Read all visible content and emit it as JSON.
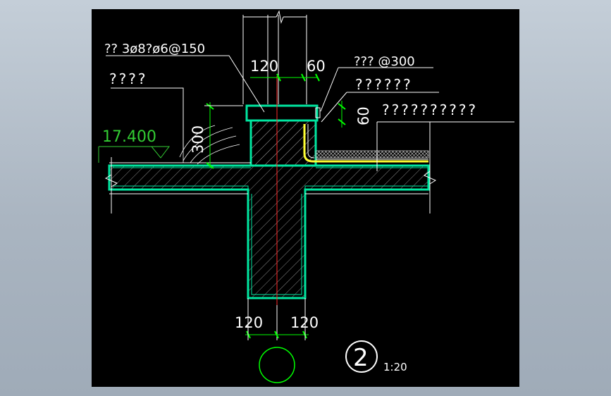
{
  "colors": {
    "background_outer": "#aab5c1",
    "paper": "#000000",
    "concrete_outline": "#00e6a0",
    "dimension": "#00ff00",
    "annotation_text": "#ffffff",
    "leader": "#ffffff",
    "elevation": "#33cc33",
    "center_line": "#ff2a2a",
    "waterproof_layer": "#ffff33",
    "hatch": "#9a9a9a",
    "axis_bubble": "#00ff00"
  },
  "labels": {
    "rebar_note": "?? 3ø8?ø6@150",
    "left_note": "????",
    "top_right_note": "??? @300",
    "right_note_1": "??????",
    "right_note_2": "??????????"
  },
  "elevation": {
    "value": "17.400"
  },
  "dimensions": {
    "top_left": "120",
    "top_right": "60",
    "side_upturn": "60",
    "left_height": "300",
    "bottom_left": "120",
    "bottom_right": "120"
  },
  "detail_marker": {
    "number": "2",
    "scale": "1:20"
  }
}
